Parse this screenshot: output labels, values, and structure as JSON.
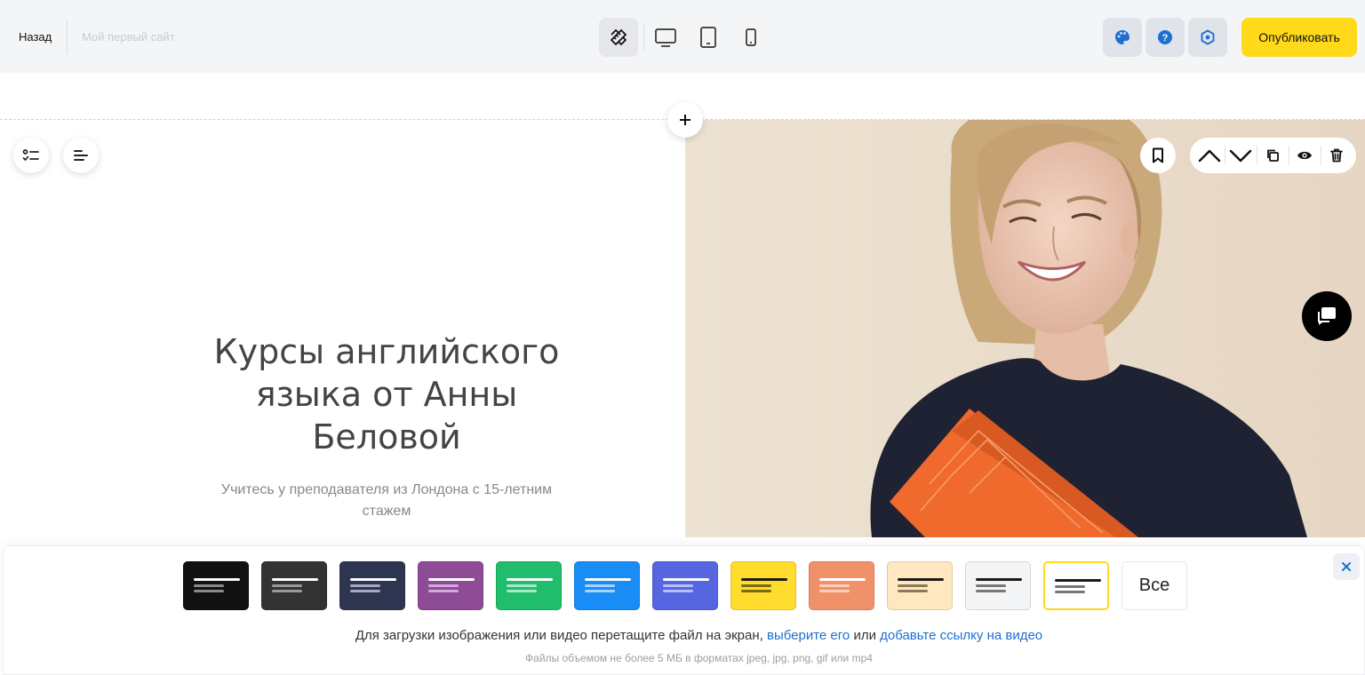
{
  "topbar": {
    "back_label": "Назад",
    "site_name": "Мой первый сайт",
    "publish_label": "Опубликовать",
    "devices": [
      "design-mode-icon",
      "desktop-icon",
      "tablet-icon",
      "mobile-icon"
    ],
    "tools": [
      "palette-icon",
      "help-icon",
      "settings-icon"
    ]
  },
  "hero": {
    "title": "Курсы английского языка от Анны Беловой",
    "subtitle": "Учитесь у преподавателя из Лондона с 15-летним стажем"
  },
  "block_toolbar": [
    "bookmark-icon",
    "move-up-icon",
    "move-down-icon",
    "duplicate-icon",
    "visibility-icon",
    "delete-icon"
  ],
  "style_panel": {
    "swatches": [
      {
        "bg": "#111111",
        "line1": "#ffffff",
        "line2": "#8a8a8a",
        "selected": false
      },
      {
        "bg": "#333333",
        "line1": "#ffffff",
        "line2": "#9a9a9a",
        "selected": false
      },
      {
        "bg": "#2e3550",
        "line1": "#ffffff",
        "line2": "#a3a9c2",
        "selected": false
      },
      {
        "bg": "#8e4b96",
        "line1": "#ffffff",
        "line2": "#d3a8da",
        "selected": false
      },
      {
        "bg": "#1fbd6c",
        "line1": "#ffffff",
        "line2": "#a7e8c6",
        "selected": false
      },
      {
        "bg": "#1a8cf5",
        "line1": "#ffffff",
        "line2": "#a8d2fb",
        "selected": false
      },
      {
        "bg": "#5566e0",
        "line1": "#ffffff",
        "line2": "#b7befa",
        "selected": false
      },
      {
        "bg": "#ffdc2e",
        "line1": "#1a1a1a",
        "line2": "#7a6a10",
        "selected": false
      },
      {
        "bg": "#f0916a",
        "line1": "#ffffff",
        "line2": "#fcd0bd",
        "selected": false
      },
      {
        "bg": "#ffe8c0",
        "line1": "#1a1a1a",
        "line2": "#8a7a5a",
        "selected": false
      },
      {
        "bg": "#f4f5f7",
        "line1": "#1a1a1a",
        "line2": "#777777",
        "selected": false
      },
      {
        "bg": "#ffffff",
        "line1": "#1a1a1a",
        "line2": "#777777",
        "selected": true
      }
    ],
    "all_label": "Все",
    "selected_border": "#ffd91a"
  },
  "upload": {
    "text": "Для загрузки изображения или видео перетащите файл на экран,",
    "choose_link": "выберите его",
    "or_text": "или",
    "video_link": "добавьте ссылку на видео",
    "hint": "Файлы объемом не более 5 МБ в форматах jpeg, jpg, png, gif или mp4"
  },
  "colors": {
    "accent": "#ffd91a",
    "link": "#1f6fd0",
    "tool_bg": "#dfe3ea",
    "tool_icon": "#1f6fd0"
  }
}
